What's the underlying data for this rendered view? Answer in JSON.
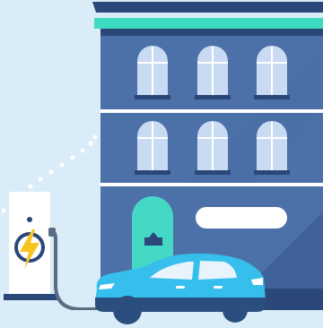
{
  "scene": {
    "subject": "electric-car-charging-at-station-in-front-of-building",
    "icons": [
      "lightning-bolt-icon",
      "power-icon",
      "mailbox-icon"
    ],
    "colors": {
      "background": "#d9ecf8",
      "building": "#4c70a8",
      "building_dark": "#3d5f96",
      "roof": "#2b4779",
      "roof_accent": "#3ddbc0",
      "window_glass": "#c9daf3",
      "window_sill": "#2b4779",
      "door": "#45d8c4",
      "sign": "#ffffff",
      "car_body": "#36bfed",
      "car_dark": "#2a4e7e",
      "car_window": "#e8f3fb",
      "charger_body": "#ffffff",
      "charger_base": "#2b4779",
      "bolt": "#f7c520",
      "cable": "#5b6d83"
    }
  }
}
